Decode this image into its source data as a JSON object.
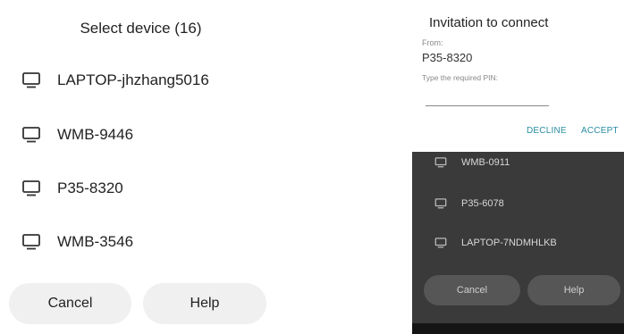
{
  "left_dialog": {
    "title": "Select device (16)",
    "devices": [
      {
        "name": "LAPTOP-jhzhang5016",
        "icon": "monitor-icon"
      },
      {
        "name": "WMB-9446",
        "icon": "monitor-icon"
      },
      {
        "name": "P35-8320",
        "icon": "monitor-icon"
      },
      {
        "name": "WMB-3546",
        "icon": "monitor-icon"
      }
    ],
    "cancel_label": "Cancel",
    "help_label": "Help"
  },
  "invitation": {
    "title": "Invitation to connect",
    "from_label": "From:",
    "from_value": "P35-8320",
    "pin_label": "Type the required PIN:",
    "pin_value": "",
    "decline_label": "DECLINE",
    "accept_label": "ACCEPT",
    "accent_color": "#2a8da0"
  },
  "background_list": {
    "devices": [
      {
        "name": "WMB-0911",
        "icon": "monitor-icon"
      },
      {
        "name": "P35-6078",
        "icon": "monitor-icon"
      },
      {
        "name": "LAPTOP-7NDMHLKB",
        "icon": "monitor-icon"
      }
    ],
    "cancel_label": "Cancel",
    "help_label": "Help"
  }
}
